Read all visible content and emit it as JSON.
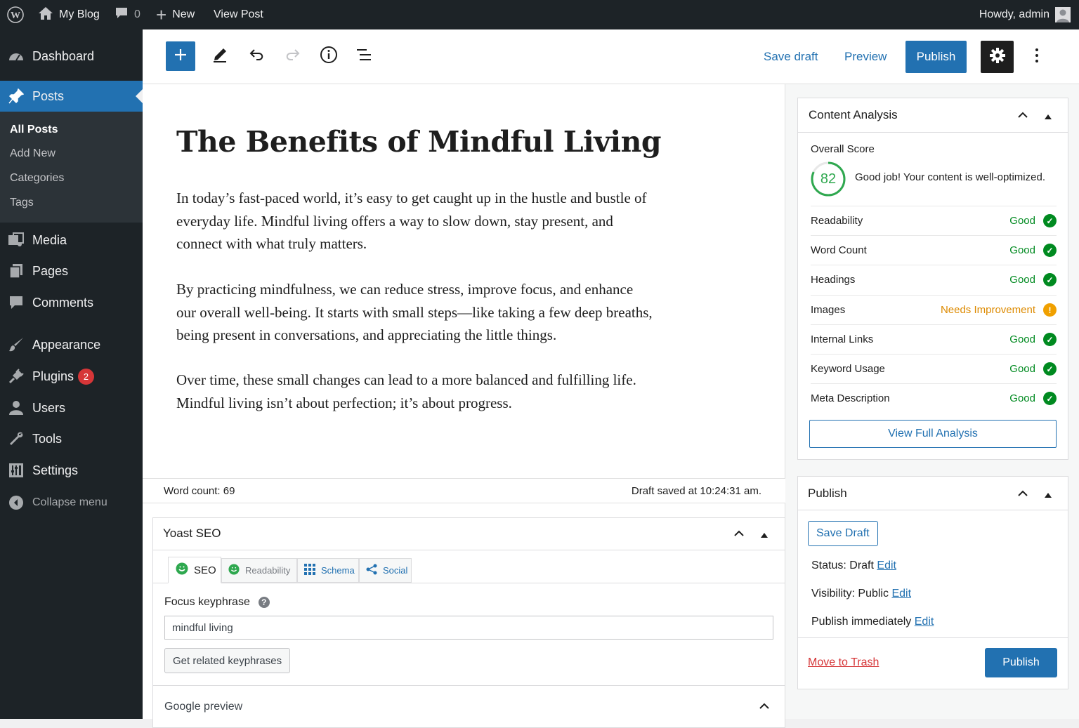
{
  "admin_bar": {
    "site_name": "My Blog",
    "comments_count": "0",
    "new_label": "New",
    "view_post_label": "View Post",
    "greeting": "Howdy, admin"
  },
  "sidebar": {
    "items": [
      {
        "label": "Dashboard",
        "icon": "dashboard-icon"
      },
      {
        "label": "Posts",
        "icon": "pin-icon"
      },
      {
        "label": "Media",
        "icon": "media-icon"
      },
      {
        "label": "Pages",
        "icon": "pages-icon"
      },
      {
        "label": "Comments",
        "icon": "comments-icon"
      },
      {
        "label": "Appearance",
        "icon": "brush-icon"
      },
      {
        "label": "Plugins",
        "icon": "plugins-icon"
      },
      {
        "label": "Users",
        "icon": "users-icon"
      },
      {
        "label": "Tools",
        "icon": "wrench-icon"
      },
      {
        "label": "Settings",
        "icon": "settings-icon"
      }
    ],
    "posts_submenu": [
      "All Posts",
      "Add New",
      "Categories",
      "Tags"
    ],
    "plugins_badge": "2",
    "collapse_label": "Collapse menu"
  },
  "toolbar": {
    "save_draft": "Save draft",
    "preview": "Preview",
    "publish": "Publish"
  },
  "post": {
    "title": "The Benefits of Mindful Living",
    "paragraphs": [
      "In today’s fast-paced world, it’s easy to get caught up in the hustle and bustle of everyday life. Mindful living offers a way to slow down, stay present, and connect with what truly matters.",
      "By practicing mindfulness, we can reduce stress, improve focus, and enhance our overall well-being. It starts with small steps—like taking a few deep breaths, being present in conversations, and appreciating the little things.",
      "Over time, these small changes can lead to a more balanced and fulfilling life. Mindful living isn’t about perfection; it’s about progress."
    ],
    "word_count": "Word count: 69",
    "saved_status": "Draft saved at 10:24:31 am."
  },
  "yoast": {
    "title": "Yoast SEO",
    "tabs": [
      "SEO",
      "Readability",
      "Schema",
      "Social"
    ],
    "focus_label": "Focus keyphrase",
    "focus_value": "mindful living",
    "related_button": "Get related keyphrases",
    "google_preview": "Google preview"
  },
  "analysis": {
    "title": "Content Analysis",
    "overall_label": "Overall Score",
    "score": "82",
    "score_fraction": 0.82,
    "score_message": "Good job! Your content is well-optimized.",
    "rows": [
      {
        "label": "Readability",
        "status": "Good"
      },
      {
        "label": "Word Count",
        "status": "Good"
      },
      {
        "label": "Headings",
        "status": "Good"
      },
      {
        "label": "Images",
        "status": "Needs Improvement"
      },
      {
        "label": "Internal Links",
        "status": "Good"
      },
      {
        "label": "Keyword Usage",
        "status": "Good"
      },
      {
        "label": "Meta Description",
        "status": "Good"
      }
    ],
    "full_button": "View Full Analysis"
  },
  "publish_panel": {
    "title": "Publish",
    "save_draft": "Save Draft",
    "status_label": "Status:",
    "status_value": "Draft",
    "visibility_label": "Visibility:",
    "visibility_value": "Public",
    "publish_label": "Publish",
    "publish_value": "immediately",
    "edit": "Edit",
    "trash": "Move to Trash",
    "publish_button": "Publish"
  },
  "colors": {
    "admin_dark": "#1d2327",
    "accent_blue": "#2271b1",
    "good_green": "#008a20",
    "warn_orange": "#dd8a00",
    "trash_red": "#d63638"
  }
}
